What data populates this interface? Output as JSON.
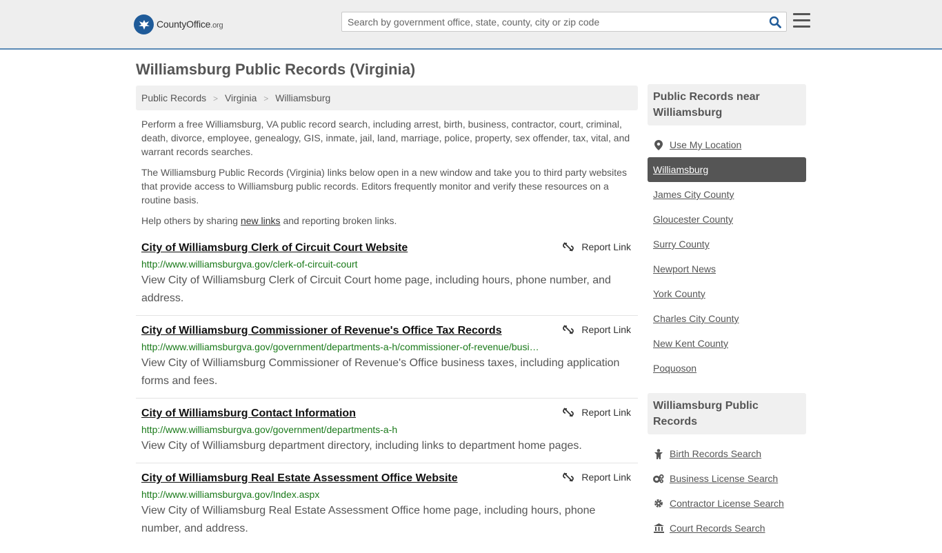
{
  "header": {
    "logo_name": "CountyOffice",
    "logo_tld": ".org",
    "search_placeholder": "Search by government office, state, county, city or zip code"
  },
  "page": {
    "title": "Williamsburg Public Records (Virginia)",
    "breadcrumb": [
      "Public Records",
      "Virginia",
      "Williamsburg"
    ],
    "intro1": "Perform a free Williamsburg, VA public record search, including arrest, birth, business, contractor, court, criminal, death, divorce, employee, genealogy, GIS, inmate, jail, land, marriage, police, property, sex offender, tax, vital, and warrant records searches.",
    "intro2": "The Williamsburg Public Records (Virginia) links below open in a new window and take you to third party websites that provide access to Williamsburg public records. Editors frequently monitor and verify these resources on a routine basis.",
    "help_prefix": "Help others by sharing",
    "help_link": "new links",
    "help_suffix": "and reporting broken links."
  },
  "report_label": "Report Link",
  "records": [
    {
      "title": "City of Williamsburg Clerk of Circuit Court Website",
      "url": "http://www.williamsburgva.gov/clerk-of-circuit-court",
      "desc": "View City of Williamsburg Clerk of Circuit Court home page, including hours, phone number, and address."
    },
    {
      "title": "City of Williamsburg Commissioner of Revenue's Office Tax Records",
      "url": "http://www.williamsburgva.gov/government/departments-a-h/commissioner-of-revenue/busi…",
      "desc": "View City of Williamsburg Commissioner of Revenue's Office business taxes, including application forms and fees."
    },
    {
      "title": "City of Williamsburg Contact Information",
      "url": "http://www.williamsburgva.gov/government/departments-a-h",
      "desc": "View City of Williamsburg department directory, including links to department home pages."
    },
    {
      "title": "City of Williamsburg Real Estate Assessment Office Website",
      "url": "http://www.williamsburgva.gov/Index.aspx",
      "desc": "View City of Williamsburg Real Estate Assessment Office home page, including hours, phone number, and address."
    }
  ],
  "sidebar": {
    "near_heading": "Public Records near Williamsburg",
    "use_location": "Use My Location",
    "near_items": [
      "Williamsburg",
      "James City County",
      "Gloucester County",
      "Surry County",
      "Newport News",
      "York County",
      "Charles City County",
      "New Kent County",
      "Poquoson"
    ],
    "active_item": "Williamsburg",
    "records_heading": "Williamsburg Public Records",
    "record_links": [
      {
        "label": "Birth Records Search",
        "icon": "baby-icon"
      },
      {
        "label": "Business License Search",
        "icon": "gears-icon"
      },
      {
        "label": "Contractor License Search",
        "icon": "gear-icon"
      },
      {
        "label": "Court Records Search",
        "icon": "courthouse-icon"
      }
    ]
  },
  "colors": {
    "header_bg": "#eeeeee",
    "header_border": "#5b8ab5",
    "logo_blue": "#1f5b99",
    "url_green": "#1a7a1a",
    "active_bg": "#555555"
  }
}
